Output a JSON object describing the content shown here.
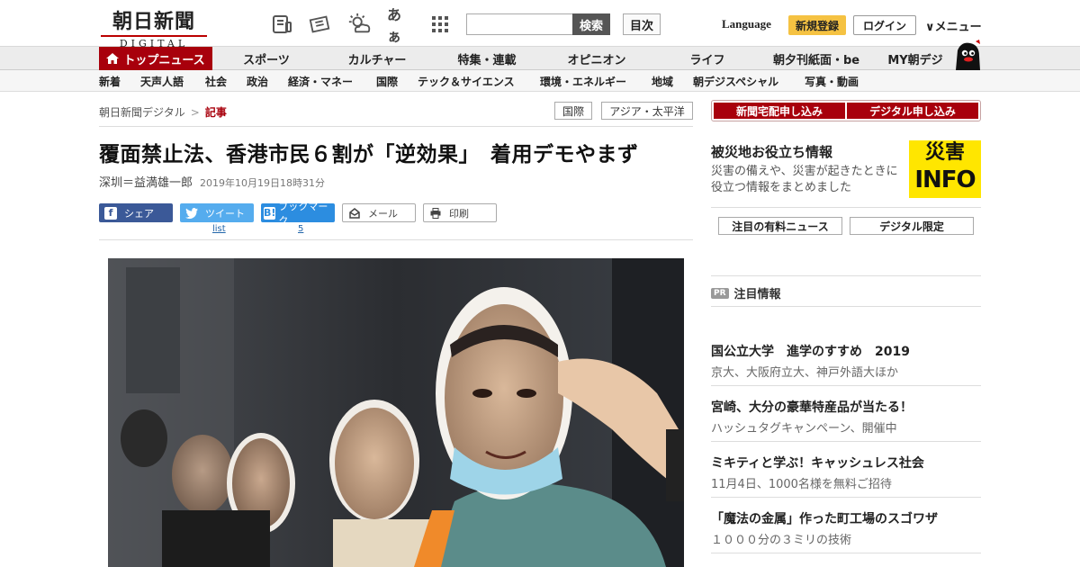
{
  "header": {
    "logo_jp": "朝日新聞",
    "logo_en": "DIGITAL",
    "font_toggle": "あぁ",
    "search_button": "検索",
    "toc_button": "目次",
    "language": "Language",
    "register": "新規登録",
    "login": "ログイン",
    "menu": "メニュー"
  },
  "nav": {
    "top": "トップニュース",
    "items": [
      "スポーツ",
      "カルチャー",
      "特集・連載",
      "オピニオン",
      "ライフ",
      "朝夕刊紙面・be",
      "MY朝デジ"
    ]
  },
  "subnav": {
    "items": [
      "新着",
      "天声人語",
      "社会",
      "政治",
      "経済・マネー",
      "国際",
      "テック＆サイエンス",
      "環境・エネルギー",
      "地域",
      "朝デジスペシャル",
      "写真・動画"
    ]
  },
  "breadcrumb": {
    "home": "朝日新聞デジタル",
    "separator": ">",
    "current": "記事"
  },
  "tags": [
    "国際",
    "アジア・太平洋"
  ],
  "article": {
    "headline": "覆面禁止法、香港市民６割が「逆効果」　着用デモやまず",
    "author": "深圳＝益満雄一郎",
    "date": "2019年10月19日18時31分"
  },
  "share": {
    "facebook": "シェア",
    "twitter": "ツイート",
    "hatena": "ブックマーク",
    "mail": "メール",
    "print": "印刷",
    "twitter_count": "list",
    "hatena_count": "5"
  },
  "sidebar": {
    "apply_paper": "新聞宅配申し込み",
    "apply_digital": "デジタル申し込み",
    "disaster_title": "被災地お役立ち情報",
    "disaster_desc": "災害の備えや、災害が起きたときに役立つ情報をまとめました",
    "disaster_badge_top": "災害",
    "disaster_badge_bottom": "INFO",
    "tab_paid": "注目の有料ニュース",
    "tab_digital": "デジタル限定",
    "pr_badge": "PR",
    "pr_heading": "注目情報",
    "pr_items": [
      {
        "title": "国公立大学　進学のすすめ　2019",
        "sub": "京大、大阪府立大、神戸外語大ほか"
      },
      {
        "title": "宮崎、大分の豪華特産品が当たる！",
        "sub": "ハッシュタグキャンペーン、開催中"
      },
      {
        "title": "ミキティと学ぶ！キャッシュレス社会",
        "sub": "11月4日、1000名様を無料ご招待"
      },
      {
        "title": "「魔法の金属」作った町工場のスゴワザ",
        "sub": "１０００分の３ミリの技術"
      }
    ]
  },
  "colors": {
    "brand_red": "#a8000c",
    "register_yellow": "#f5c242",
    "facebook": "#3b5998",
    "twitter": "#55acee",
    "hatena": "#2c8de0",
    "disaster_yellow": "#ffe600"
  }
}
